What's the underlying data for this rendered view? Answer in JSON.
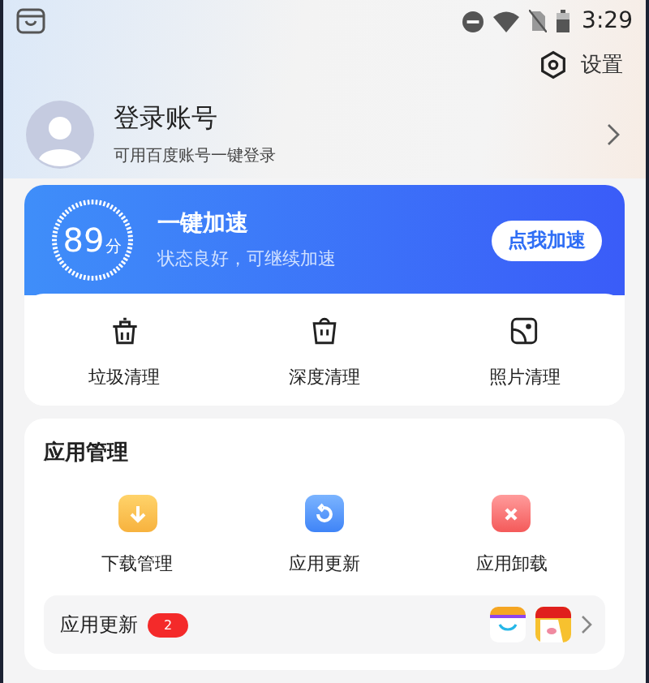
{
  "status_bar": {
    "time": "3:29"
  },
  "settings": {
    "label": "设置"
  },
  "account": {
    "title": "登录账号",
    "subtitle": "可用百度账号一键登录"
  },
  "boost": {
    "score": "89",
    "unit": "分",
    "title": "一键加速",
    "subtitle": "状态良好，可继续加速",
    "button": "点我加速"
  },
  "clean_tools": [
    {
      "kind": "junk",
      "label": "垃圾清理"
    },
    {
      "kind": "deep",
      "label": "深度清理"
    },
    {
      "kind": "photo",
      "label": "照片清理"
    }
  ],
  "app_management": {
    "title": "应用管理",
    "tools": [
      {
        "kind": "download",
        "label": "下载管理"
      },
      {
        "kind": "update",
        "label": "应用更新"
      },
      {
        "kind": "uninstall",
        "label": "应用卸载"
      }
    ],
    "updates_row": {
      "label": "应用更新",
      "count": "2"
    }
  }
}
